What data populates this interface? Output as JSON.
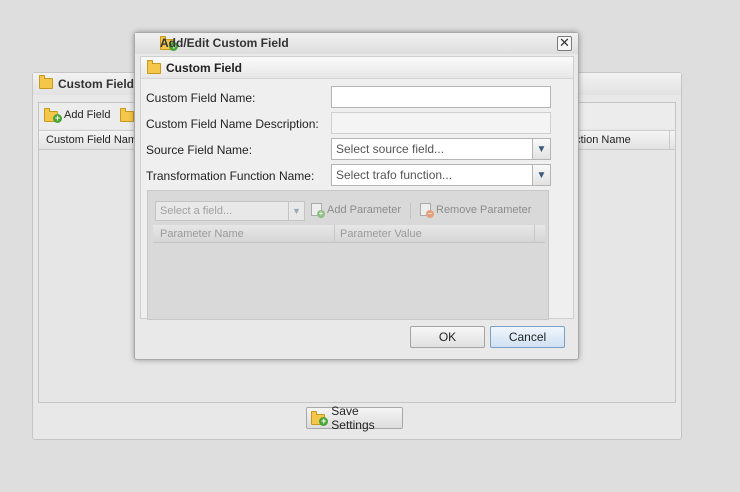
{
  "background_panel": {
    "title": "Custom Field C",
    "toolbar": {
      "add_field_label": "Add Field"
    },
    "grid": {
      "col1": "Custom Field Nam",
      "col2": "nction Name"
    },
    "save_label": "Save Settings"
  },
  "dialog": {
    "title": "Add/Edit Custom Field",
    "close_glyph": "✕",
    "fieldset_title": "Custom Field",
    "labels": {
      "name": "Custom Field Name:",
      "description": "Custom Field Name Description:",
      "source": "Source Field Name:",
      "trafo": "Transformation Function Name:"
    },
    "inputs": {
      "name_value": "",
      "description_value": "",
      "source_placeholder": "Select source field...",
      "trafo_placeholder": "Select trafo function..."
    },
    "parameters": {
      "field_placeholder": "Select a field...",
      "add_label": "Add Parameter",
      "remove_label": "Remove Parameter",
      "col_name": "Parameter Name",
      "col_value": "Parameter Value"
    },
    "ok_label": "OK",
    "cancel_label": "Cancel"
  },
  "colors": {
    "accent": "#7aa0c6",
    "folder": "#f4c64a",
    "add_badge": "#4aa536",
    "remove_badge": "#e07a3a"
  },
  "icons": {
    "folder": "folder-icon",
    "add": "folder-add-icon",
    "close": "close-icon",
    "dropdown": "chevron-down-icon"
  }
}
